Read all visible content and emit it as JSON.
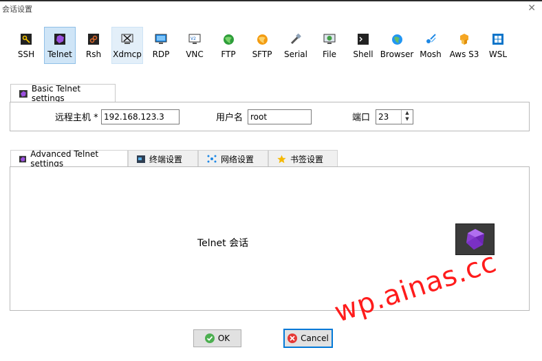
{
  "window": {
    "title": "会话设置"
  },
  "toolbar": [
    {
      "key": "ssh",
      "label": "SSH",
      "icon": "ssh-icon"
    },
    {
      "key": "telnet",
      "label": "Telnet",
      "icon": "telnet-icon",
      "state": "selected"
    },
    {
      "key": "rsh",
      "label": "Rsh",
      "icon": "rsh-icon"
    },
    {
      "key": "xdmcp",
      "label": "Xdmcp",
      "icon": "xdmcp-icon",
      "state": "hover"
    },
    {
      "key": "rdp",
      "label": "RDP",
      "icon": "rdp-icon"
    },
    {
      "key": "vnc",
      "label": "VNC",
      "icon": "vnc-icon"
    },
    {
      "key": "ftp",
      "label": "FTP",
      "icon": "ftp-icon"
    },
    {
      "key": "sftp",
      "label": "SFTP",
      "icon": "sftp-icon"
    },
    {
      "key": "serial",
      "label": "Serial",
      "icon": "serial-icon"
    },
    {
      "key": "file",
      "label": "File",
      "icon": "file-icon"
    },
    {
      "key": "shell",
      "label": "Shell",
      "icon": "shell-icon"
    },
    {
      "key": "browser",
      "label": "Browser",
      "icon": "browser-icon"
    },
    {
      "key": "mosh",
      "label": "Mosh",
      "icon": "mosh-icon"
    },
    {
      "key": "awss3",
      "label": "Aws S3",
      "icon": "aws-s3-icon"
    },
    {
      "key": "wsl",
      "label": "WSL",
      "icon": "wsl-icon"
    }
  ],
  "basic": {
    "tab_label": "Basic Telnet settings",
    "host_label": "远程主机 *",
    "host_value": "192.168.123.3",
    "user_label": "用户名",
    "user_value": "root",
    "port_label": "端口",
    "port_value": "23"
  },
  "advanced_tabs": [
    {
      "label": "Advanced Telnet settings",
      "icon": "telnet-icon",
      "active": true
    },
    {
      "label": "终端设置",
      "icon": "terminal-icon"
    },
    {
      "label": "网络设置",
      "icon": "network-icon"
    },
    {
      "label": "书签设置",
      "icon": "star-icon"
    }
  ],
  "advanced_panel": {
    "session_text": "Telnet 会话"
  },
  "buttons": {
    "ok": "OK",
    "cancel": "Cancel"
  },
  "watermark": "wp.ainas.cc",
  "colors": {
    "accent": "#0078d7",
    "selected_bg": "#cfe5f7",
    "watermark": "#ff1c1c",
    "gem": "#8a3fd1"
  }
}
